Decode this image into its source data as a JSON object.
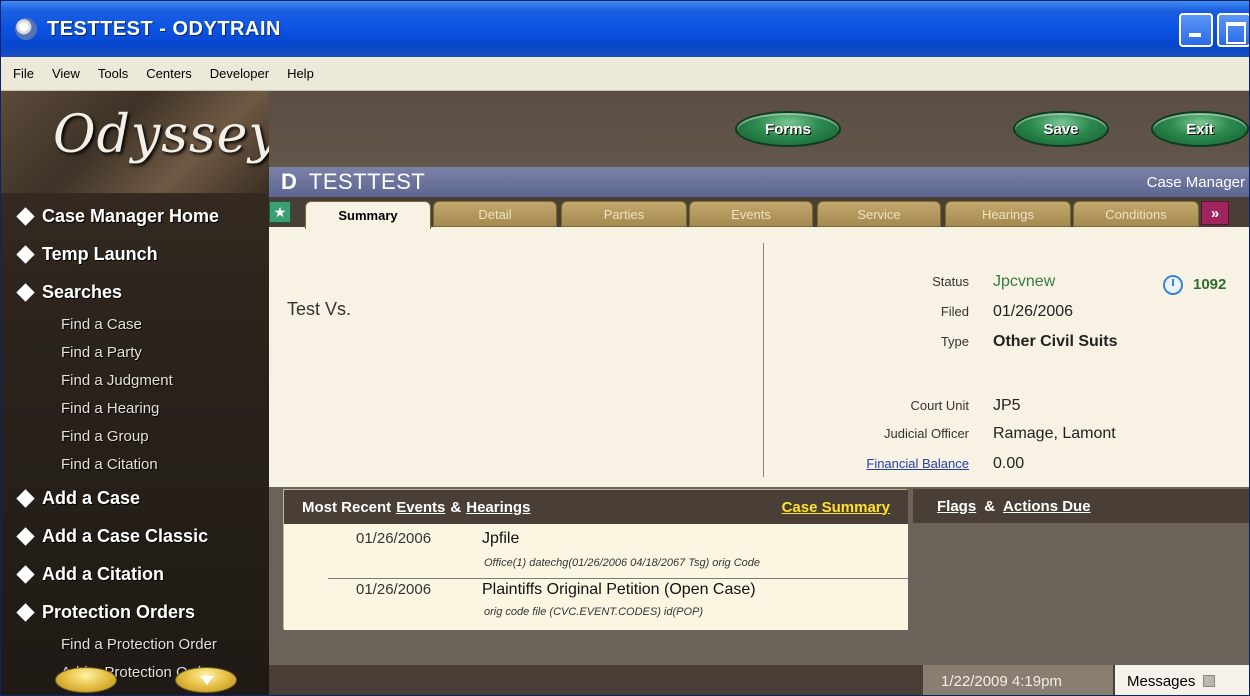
{
  "window": {
    "title": "TESTTEST - ODYTRAIN"
  },
  "menu": [
    "File",
    "View",
    "Tools",
    "Centers",
    "Developer",
    "Help"
  ],
  "logo": "Odyssey",
  "nav": {
    "case_manager_home": "Case Manager Home",
    "temp_launch": "Temp Launch",
    "searches": "Searches",
    "search_items": [
      "Find a Case",
      "Find a Party",
      "Find a Judgment",
      "Find a Hearing",
      "Find a Group",
      "Find a Citation"
    ],
    "add_case": "Add a Case",
    "add_case_classic": "Add a Case Classic",
    "add_citation": "Add a Citation",
    "protection_orders": "Protection Orders",
    "protection_items": [
      "Find a Protection Order",
      "Add a Protection Order"
    ]
  },
  "toolbar": {
    "forms": "Forms",
    "save": "Save",
    "exit": "Exit"
  },
  "case": {
    "mark": "D",
    "title": "TESTTEST",
    "manager": "Case Manager"
  },
  "tabs": [
    "Summary",
    "Detail",
    "Parties",
    "Events",
    "Service",
    "Hearings",
    "Conditions"
  ],
  "tab_more": "»",
  "summary": {
    "case_name": "Test Vs.",
    "status_label": "Status",
    "status_value": "Jpcvnew",
    "filed_label": "Filed",
    "filed_value": "01/26/2006",
    "type_label": "Type",
    "type_value": "Other Civil Suits",
    "court_unit_label": "Court Unit",
    "court_unit_value": "JP5",
    "judicial_officer_label": "Judicial Officer",
    "judicial_officer_value": "Ramage, Lamont",
    "financial_label": "Financial Balance",
    "financial_value": "0.00",
    "clock_number": "1092"
  },
  "events_panel": {
    "head_prefix": "Most Recent",
    "events_link": "Events",
    "amp": "&",
    "hearings_link": "Hearings",
    "case_summary": "Case Summary",
    "rows": [
      {
        "date": "01/26/2006",
        "title": "Jpfile",
        "sub": "Office(1) datechg(01/26/2006 04/18/2067 Tsg) orig Code"
      },
      {
        "date": "01/26/2006",
        "title": "Plaintiffs Original Petition (Open Case)",
        "sub": "orig code file (CVC.EVENT.CODES) id(POP)"
      }
    ]
  },
  "flags_panel": {
    "flags": "Flags",
    "amp": "&",
    "actions_due": "Actions Due"
  },
  "status": {
    "datetime": "1/22/2009 4:19pm",
    "messages": "Messages"
  }
}
